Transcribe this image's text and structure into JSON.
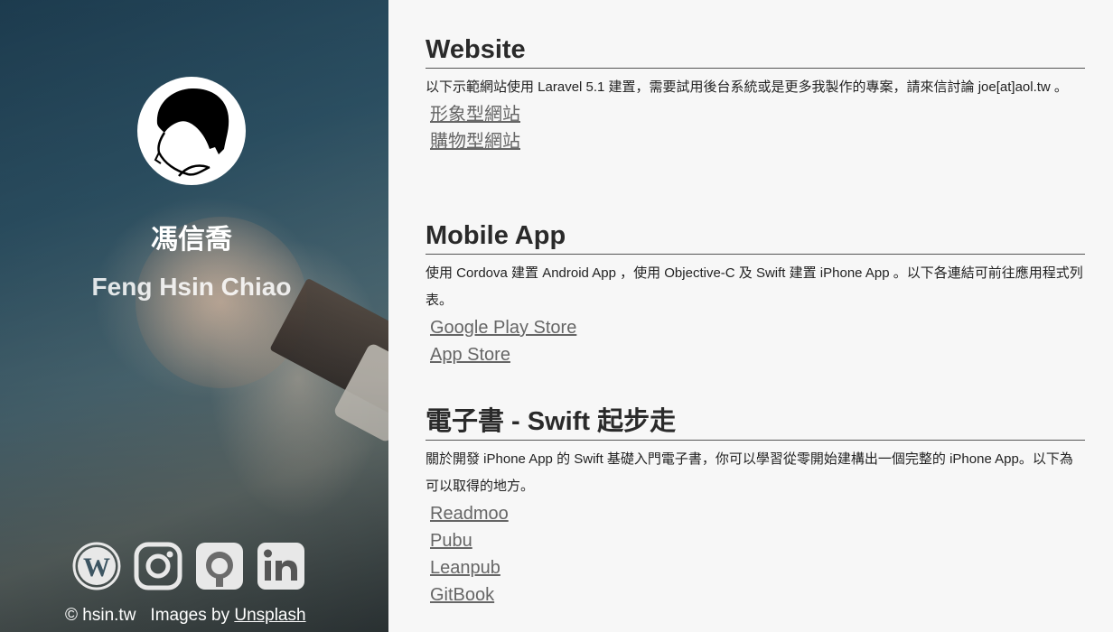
{
  "profile": {
    "name_zh": "馮信喬",
    "name_en": "Feng Hsin Chiao"
  },
  "socials": [
    {
      "name": "wordpress-icon"
    },
    {
      "name": "instagram-icon"
    },
    {
      "name": "github-icon"
    },
    {
      "name": "linkedin-icon"
    }
  ],
  "footer": {
    "copyright": "© hsin.tw",
    "images_by": "Images by",
    "unsplash": "Unsplash"
  },
  "sections": [
    {
      "title": "Website",
      "desc": "以下示範網站使用 Laravel 5.1 建置，需要試用後台系統或是更多我製作的專案，請來信討論 joe[at]aol.tw 。",
      "links": [
        "形象型網站",
        "購物型網站"
      ]
    },
    {
      "title": "Mobile App",
      "desc": "使用 Cordova 建置 Android App ，使用 Objective-C 及 Swift 建置 iPhone App 。以下各連結可前往應用程式列表。",
      "links": [
        "Google Play Store",
        "App Store"
      ]
    },
    {
      "title": "電子書 - Swift 起步走",
      "desc": "關於開發 iPhone App 的 Swift 基礎入門電子書，你可以學習從零開始建構出一個完整的 iPhone App。以下為可以取得的地方。",
      "links": [
        "Readmoo",
        "Pubu",
        "Leanpub",
        "GitBook"
      ]
    }
  ],
  "colors": {
    "text": "#222222",
    "link": "#666666",
    "background": "#f7f7f7"
  }
}
